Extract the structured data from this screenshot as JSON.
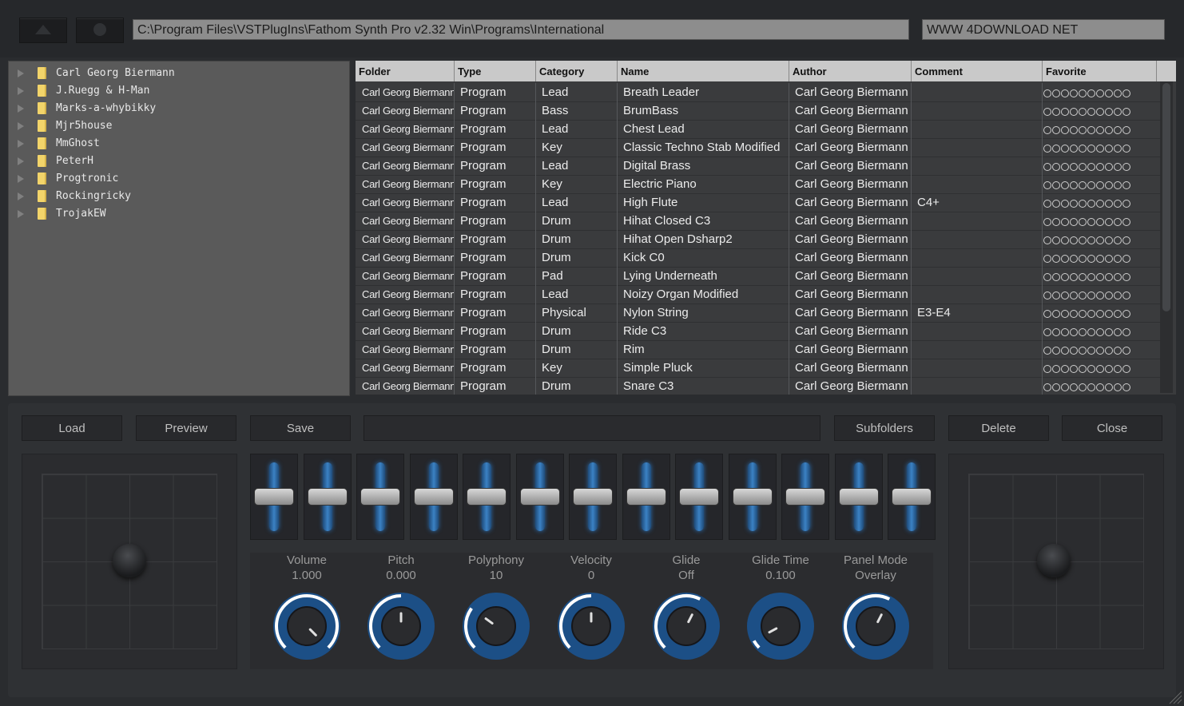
{
  "top": {
    "path": "C:\\Program Files\\VSTPlugIns\\Fathom Synth Pro v2.32 Win\\Programs\\International",
    "site": "WWW 4DOWNLOAD NET"
  },
  "folders": [
    "Carl Georg Biermann",
    "J.Ruegg & H-Man",
    "Marks-a-whybikky",
    "Mjr5house",
    "MmGhost",
    "PeterH",
    "Progtronic",
    "Rockingricky",
    "TrojakEW"
  ],
  "table": {
    "headers": [
      "Folder",
      "Type",
      "Category",
      "Name",
      "Author",
      "Comment",
      "Favorite"
    ],
    "rows": [
      [
        "Carl Georg Biermann",
        "Program",
        "Lead",
        "Breath Leader",
        "Carl Georg Biermann",
        ""
      ],
      [
        "Carl Georg Biermann",
        "Program",
        "Bass",
        "BrumBass",
        "Carl Georg Biermann",
        ""
      ],
      [
        "Carl Georg Biermann",
        "Program",
        "Lead",
        "Chest Lead",
        "Carl Georg Biermann",
        ""
      ],
      [
        "Carl Georg Biermann",
        "Program",
        "Key",
        "Classic Techno Stab Modified",
        "Carl Georg Biermann",
        ""
      ],
      [
        "Carl Georg Biermann",
        "Program",
        "Lead",
        "Digital Brass",
        "Carl Georg Biermann",
        ""
      ],
      [
        "Carl Georg Biermann",
        "Program",
        "Key",
        "Electric Piano",
        "Carl Georg Biermann",
        ""
      ],
      [
        "Carl Georg Biermann",
        "Program",
        "Lead",
        "High Flute",
        "Carl Georg Biermann",
        "C4+"
      ],
      [
        "Carl Georg Biermann",
        "Program",
        "Drum",
        "Hihat Closed C3",
        "Carl Georg Biermann",
        ""
      ],
      [
        "Carl Georg Biermann",
        "Program",
        "Drum",
        "Hihat Open Dsharp2",
        "Carl Georg Biermann",
        ""
      ],
      [
        "Carl Georg Biermann",
        "Program",
        "Drum",
        "Kick C0",
        "Carl Georg Biermann",
        ""
      ],
      [
        "Carl Georg Biermann",
        "Program",
        "Pad",
        "Lying Underneath",
        "Carl Georg Biermann",
        ""
      ],
      [
        "Carl Georg Biermann",
        "Program",
        "Lead",
        "Noizy Organ Modified",
        "Carl Georg Biermann",
        ""
      ],
      [
        "Carl Georg Biermann",
        "Program",
        "Physical",
        "Nylon String",
        "Carl Georg Biermann",
        "E3-E4"
      ],
      [
        "Carl Georg Biermann",
        "Program",
        "Drum",
        "Ride C3",
        "Carl Georg Biermann",
        ""
      ],
      [
        "Carl Georg Biermann",
        "Program",
        "Drum",
        "Rim",
        "Carl Georg Biermann",
        ""
      ],
      [
        "Carl Georg Biermann",
        "Program",
        "Key",
        "Simple Pluck",
        "Carl Georg Biermann",
        ""
      ],
      [
        "Carl Georg Biermann",
        "Program",
        "Drum",
        "Snare C3",
        "Carl Georg Biermann",
        ""
      ]
    ],
    "favorite_count": 0,
    "favorite_max": 10
  },
  "buttons": {
    "load": "Load",
    "preview": "Preview",
    "save": "Save",
    "subfolders": "Subfolders",
    "delete": "Delete",
    "close": "Close"
  },
  "sliders": {
    "count": 13,
    "level": 0.5
  },
  "knobs": [
    {
      "label": "Volume",
      "value": "1.000",
      "fill": 1.0
    },
    {
      "label": "Pitch",
      "value": "0.000",
      "fill": 0.5
    },
    {
      "label": "Polyphony",
      "value": "10",
      "fill": 0.3
    },
    {
      "label": "Velocity",
      "value": "0",
      "fill": 0.5
    },
    {
      "label": "Glide",
      "value": "Off",
      "fill": 0.6
    },
    {
      "label": "Glide Time",
      "value": "0.100",
      "fill": 0.06
    },
    {
      "label": "Panel Mode",
      "value": "Overlay",
      "fill": 0.6
    }
  ],
  "colors": {
    "accent": "#3b82c4",
    "ring": "#ffffff",
    "panel": "#2f3134"
  }
}
